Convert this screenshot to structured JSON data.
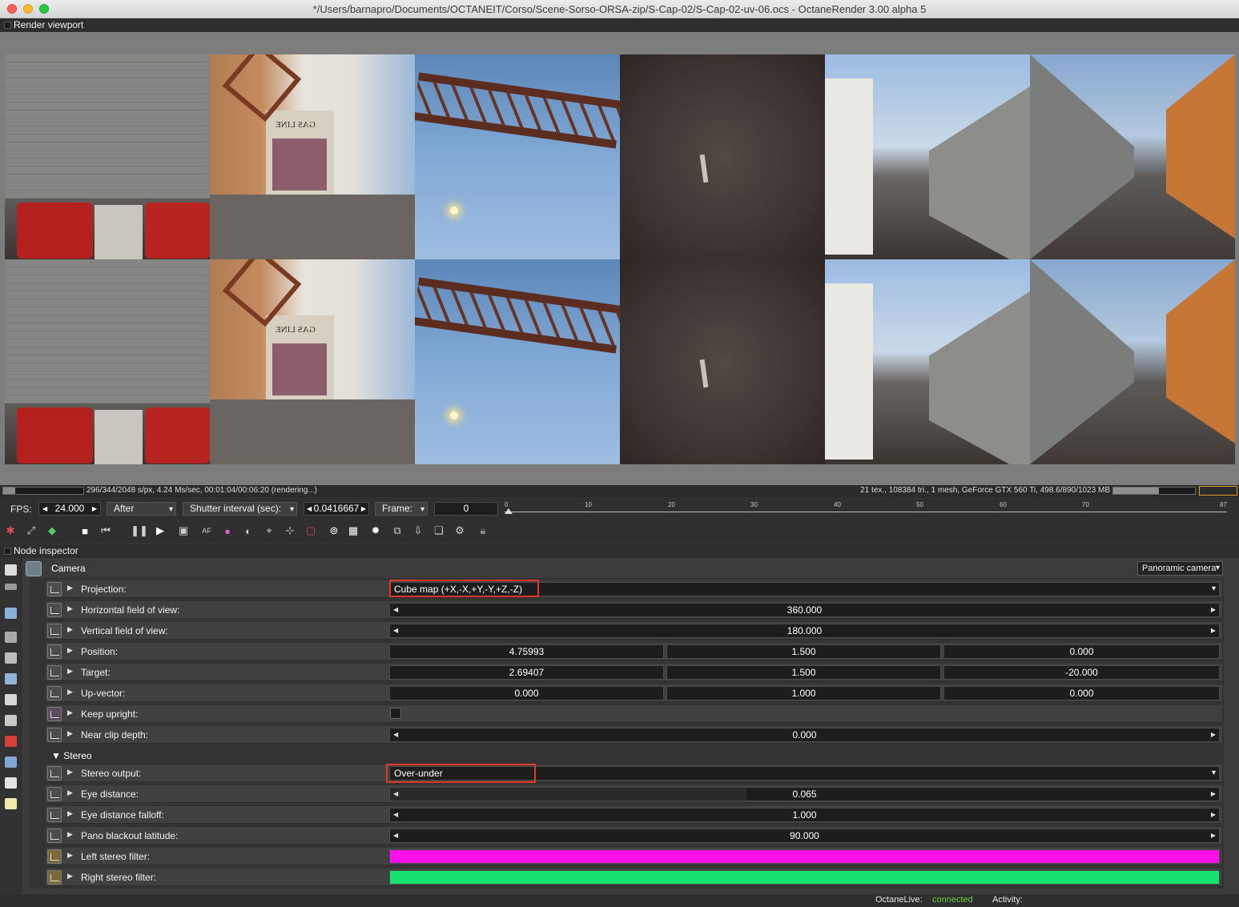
{
  "window": {
    "title": "*/Users/barnapro/Documents/OCTANEIT/Corso/Scene-Sorso-ORSA-zip/S-Cap-02/S-Cap-02-uv-06.ocs - OctaneRender 3.00 alpha 5"
  },
  "viewport": {
    "header": "Render viewport",
    "render_sign_text": "GAS LINE",
    "status_left": "296/344/2048 s/px, 4.24 Ms/sec, 00:01:04/00:06:20 (rendering...)",
    "status_right": "21 tex., 108384 tri., 1 mesh, GeForce GTX 560 Ti, 498.6/890/1023 MB",
    "progress": 0.145,
    "vram_usage": 0.56
  },
  "timeline": {
    "fps_label": "FPS:",
    "fps_value": "24.000",
    "after_label": "After",
    "shutter_label": "Shutter interval (sec):",
    "shutter_value": "0.0416667",
    "frame_label": "Frame:",
    "frame_value": "0",
    "ticks": [
      "0",
      "10",
      "20",
      "30",
      "40",
      "50",
      "60",
      "70",
      "87"
    ]
  },
  "toolbar": {
    "icons": [
      "reset-camera-icon",
      "fit-view-icon",
      "color-cube-icon",
      "stop-icon",
      "rewind-icon",
      "pause-icon",
      "play-icon",
      "region-icon",
      "af-icon",
      "color-picker-icon",
      "material-picker-icon",
      "camera-target-icon",
      "object-picker-icon",
      "focus-icon",
      "crop-icon",
      "lock-icon",
      "copy-icon",
      "export-icon",
      "layers-icon",
      "settings-icon",
      "clay-mode-icon"
    ]
  },
  "inspector": {
    "header": "Node inspector",
    "node_name": "Camera",
    "node_type": "Panoramic camera",
    "params": [
      {
        "label": "Projection:",
        "kind": "dropdown",
        "value": "Cube map (+X,-X,+Y,-Y,+Z,-Z)"
      },
      {
        "label": "Horizontal field of view:",
        "kind": "slider",
        "value": "360.000"
      },
      {
        "label": "Vertical field of view:",
        "kind": "slider",
        "value": "180.000"
      },
      {
        "label": "Position:",
        "kind": "vec3",
        "values": [
          "4.75993",
          "1.500",
          "0.000"
        ]
      },
      {
        "label": "Target:",
        "kind": "vec3",
        "values": [
          "2.69407",
          "1.500",
          "-20.000"
        ]
      },
      {
        "label": "Up-vector:",
        "kind": "vec3",
        "values": [
          "0.000",
          "1.000",
          "0.000"
        ]
      },
      {
        "label": "Keep upright:",
        "kind": "checkbox",
        "checked": false
      },
      {
        "label": "Near clip depth:",
        "kind": "slider",
        "value": "0.000"
      }
    ],
    "stereo_section": "Stereo",
    "stereo_params": [
      {
        "label": "Stereo output:",
        "kind": "dropdown",
        "value": "Over-under"
      },
      {
        "label": "Eye distance:",
        "kind": "slider",
        "value": "0.065"
      },
      {
        "label": "Eye distance falloff:",
        "kind": "slider",
        "value": "1.000"
      },
      {
        "label": "Pano blackout latitude:",
        "kind": "slider",
        "value": "90.000"
      },
      {
        "label": "Left stereo filter:",
        "kind": "color",
        "color": "#ff10ea"
      },
      {
        "label": "Right stereo filter:",
        "kind": "color",
        "color": "#16e36f"
      }
    ]
  },
  "footer": {
    "live_label": "OctaneLive:",
    "live_status": "connected",
    "activity_label": "Activity:"
  },
  "colors": {
    "highlight_box": "#e0362b",
    "connected": "#6ccf3e"
  }
}
